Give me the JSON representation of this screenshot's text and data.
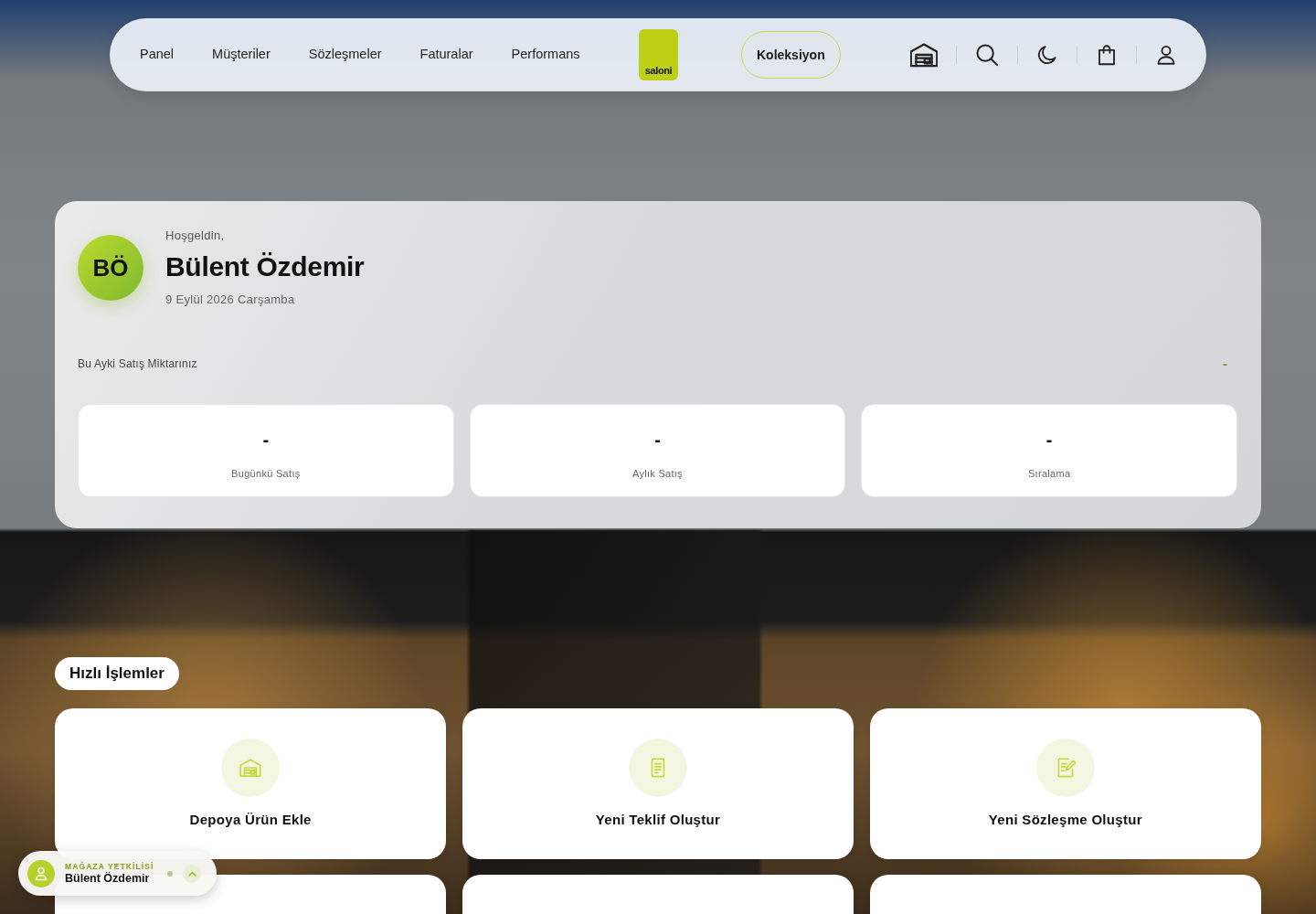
{
  "nav": {
    "links": [
      {
        "label": "Panel"
      },
      {
        "label": "Müşteriler"
      },
      {
        "label": "Sözleşmeler"
      },
      {
        "label": "Faturalar"
      },
      {
        "label": "Performans"
      }
    ],
    "logo": "saloni",
    "collection_button": "Koleksiyon"
  },
  "welcome": {
    "avatar_initials": "BÖ",
    "greeting": "Hoşgeldin,",
    "name": "Bülent Özdemir",
    "date": "9 Eylül 2026 Carşamba",
    "monthly_sales": {
      "label": "Bu Ayki Satış Miktarınız",
      "value": "-"
    },
    "stats": [
      {
        "value": "-",
        "label": "Bugünkü Satış"
      },
      {
        "value": "-",
        "label": "Aylık Satış"
      },
      {
        "value": "-",
        "label": "Sıralama"
      }
    ]
  },
  "quick_actions": {
    "title": "Hızlı İşlemler",
    "items": [
      {
        "kind": "action",
        "label": "Depoya Ürün Ekle"
      },
      {
        "kind": "action",
        "label": "Yeni Teklif Oluştur"
      },
      {
        "kind": "action",
        "label": "Yeni Sözleşme Oluştur"
      },
      {
        "kind": "cut"
      },
      {
        "kind": "cut"
      },
      {
        "kind": "cut"
      }
    ]
  },
  "user_badge": {
    "role": "MAĞAZA YETKİLİSİ",
    "name": "Bülent Özdemir"
  }
}
